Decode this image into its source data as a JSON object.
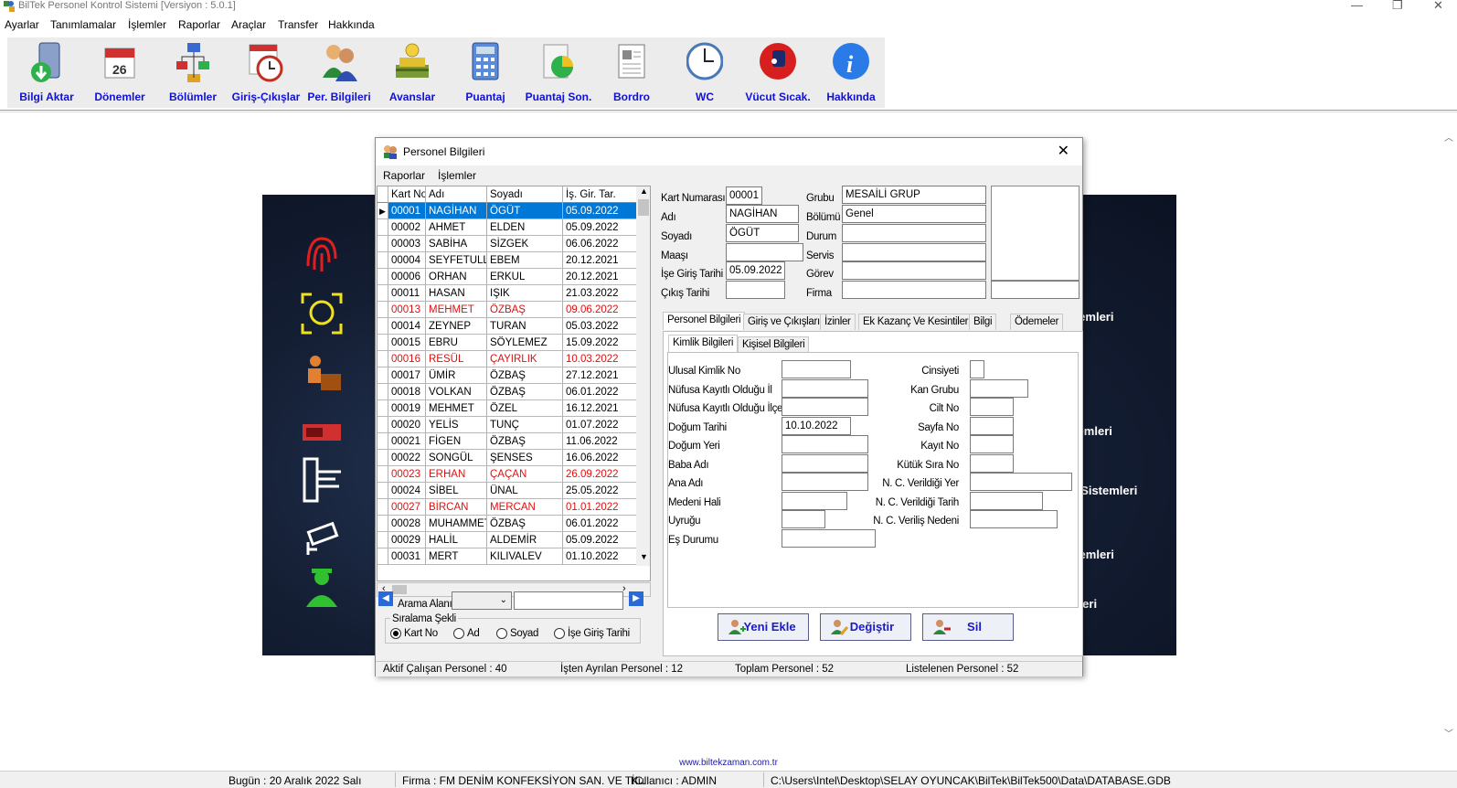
{
  "app": {
    "title": "BilTek Personel Kontrol Sistemi [Versiyon : 5.0.1]"
  },
  "menu": [
    "Ayarlar",
    "Tanımlamalar",
    "İşlemler",
    "Raporlar",
    "Araçlar",
    "Transfer",
    "Hakkında"
  ],
  "toolbar": [
    {
      "label": "Bilgi Aktar",
      "icon": "download-icon"
    },
    {
      "label": "Dönemler",
      "icon": "calendar-icon"
    },
    {
      "label": "Bölümler",
      "icon": "org-chart-icon"
    },
    {
      "label": "Giriş-Çıkışlar",
      "icon": "clock-calendar-icon"
    },
    {
      "label": "Per. Bilgileri",
      "icon": "users-icon"
    },
    {
      "label": "Avanslar",
      "icon": "money-icon"
    },
    {
      "label": "Puantaj",
      "icon": "calculator-icon"
    },
    {
      "label": "Puantaj Son.",
      "icon": "pie-chart-icon"
    },
    {
      "label": "Bordro",
      "icon": "document-icon"
    },
    {
      "label": "WC",
      "icon": "wall-clock-icon"
    },
    {
      "label": "Vücut Sıcak.",
      "icon": "thermometer-icon"
    },
    {
      "label": "Hakkında",
      "icon": "info-icon"
    }
  ],
  "background": {
    "side_texts": [
      "istemleri",
      "stemleri",
      "ol Sistemleri",
      "stemleri",
      "mleri"
    ]
  },
  "dialog": {
    "title": "Personel Bilgileri",
    "menu": [
      "Raporlar",
      "İşlemler"
    ],
    "grid_headers": [
      "Kart No",
      "Adı",
      "Soyadı",
      "İş. Gir. Tar."
    ],
    "rows": [
      {
        "kart": "00001",
        "adi": "NAGİHAN",
        "soyadi": "ÖGÜT",
        "tarih": "05.09.2022",
        "red": false,
        "selected": true
      },
      {
        "kart": "00002",
        "adi": "AHMET",
        "soyadi": "ELDEN",
        "tarih": "05.09.2022",
        "red": false
      },
      {
        "kart": "00003",
        "adi": "SABİHA",
        "soyadi": "SİZGEK",
        "tarih": "06.06.2022",
        "red": false
      },
      {
        "kart": "00004",
        "adi": "SEYFETULLA",
        "soyadi": "EBEM",
        "tarih": "20.12.2021",
        "red": false
      },
      {
        "kart": "00006",
        "adi": "ORHAN",
        "soyadi": "ERKUL",
        "tarih": "20.12.2021",
        "red": false
      },
      {
        "kart": "00011",
        "adi": "HASAN",
        "soyadi": "IŞIK",
        "tarih": "21.03.2022",
        "red": false
      },
      {
        "kart": "00013",
        "adi": "MEHMET",
        "soyadi": "ÖZBAŞ",
        "tarih": "09.06.2022",
        "red": true
      },
      {
        "kart": "00014",
        "adi": "ZEYNEP",
        "soyadi": "TURAN",
        "tarih": "05.03.2022",
        "red": false
      },
      {
        "kart": "00015",
        "adi": "EBRU",
        "soyadi": "SÖYLEMEZ",
        "tarih": "15.09.2022",
        "red": false
      },
      {
        "kart": "00016",
        "adi": "RESÜL",
        "soyadi": "ÇAYIRLIK",
        "tarih": "10.03.2022",
        "red": true
      },
      {
        "kart": "00017",
        "adi": "ÜMİR",
        "soyadi": "ÖZBAŞ",
        "tarih": "27.12.2021",
        "red": false
      },
      {
        "kart": "00018",
        "adi": "VOLKAN",
        "soyadi": "ÖZBAŞ",
        "tarih": "06.01.2022",
        "red": false
      },
      {
        "kart": "00019",
        "adi": "MEHMET",
        "soyadi": "ÖZEL",
        "tarih": "16.12.2021",
        "red": false
      },
      {
        "kart": "00020",
        "adi": "YELİS",
        "soyadi": "TUNÇ",
        "tarih": "01.07.2022",
        "red": false
      },
      {
        "kart": "00021",
        "adi": "FİGEN",
        "soyadi": "ÖZBAŞ",
        "tarih": "11.06.2022",
        "red": false
      },
      {
        "kart": "00022",
        "adi": "SONGÜL",
        "soyadi": "ŞENSES",
        "tarih": "16.06.2022",
        "red": false
      },
      {
        "kart": "00023",
        "adi": "ERHAN",
        "soyadi": "ÇAÇAN",
        "tarih": "26.09.2022",
        "red": true
      },
      {
        "kart": "00024",
        "adi": "SİBEL",
        "soyadi": "ÜNAL",
        "tarih": "25.05.2022",
        "red": false
      },
      {
        "kart": "00027",
        "adi": "BİRCAN",
        "soyadi": "MERCAN",
        "tarih": "01.01.2022",
        "red": true
      },
      {
        "kart": "00028",
        "adi": "MUHAMMET",
        "soyadi": "ÖZBAŞ",
        "tarih": "06.01.2022",
        "red": false
      },
      {
        "kart": "00029",
        "adi": "HALİL",
        "soyadi": "ALDEMİR",
        "tarih": "05.09.2022",
        "red": false
      },
      {
        "kart": "00031",
        "adi": "MERT",
        "soyadi": "KILIVALEV",
        "tarih": "01.10.2022",
        "red": false
      }
    ],
    "search_label": "Arama Alanı",
    "sort_label": "Sıralama Şekli",
    "sort_options": [
      "Kart No",
      "Ad",
      "Soyad",
      "İşe Giriş Tarihi"
    ],
    "fields_left": [
      {
        "label": "Kart Numarası",
        "value": "00001"
      },
      {
        "label": "Adı",
        "value": "NAGİHAN"
      },
      {
        "label": "Soyadı",
        "value": "ÖGÜT"
      },
      {
        "label": "Maaşı",
        "value": ""
      },
      {
        "label": "İşe Giriş Tarihi",
        "value": "05.09.2022"
      },
      {
        "label": "Çıkış Tarihi",
        "value": ""
      }
    ],
    "fields_right": [
      {
        "label": "Grubu",
        "value": "MESAİLİ GRUP"
      },
      {
        "label": "Bölümü",
        "value": "Genel"
      },
      {
        "label": "Durum",
        "value": ""
      },
      {
        "label": "Servis",
        "value": ""
      },
      {
        "label": "Görev",
        "value": ""
      },
      {
        "label": "Firma",
        "value": ""
      }
    ],
    "tabs": [
      "Personel Bilgileri",
      "Giriş ve Çıkışları",
      "İzinler",
      "Ek Kazanç Ve Kesintiler",
      "Bilgi",
      "Ödemeler"
    ],
    "subtabs": [
      "Kimlik Bilgileri",
      "Kişisel Bilgileri"
    ],
    "kimlik_left": [
      {
        "label": "Ulusal Kimlik No",
        "value": ""
      },
      {
        "label": "Nüfusa Kayıtlı Olduğu İl",
        "value": ""
      },
      {
        "label": "Nüfusa Kayıtlı Olduğu İlçe",
        "value": ""
      },
      {
        "label": "Doğum Tarihi",
        "value": "10.10.2022"
      },
      {
        "label": "Doğum Yeri",
        "value": ""
      },
      {
        "label": "Baba Adı",
        "value": ""
      },
      {
        "label": "Ana Adı",
        "value": ""
      },
      {
        "label": "Medeni Hali",
        "value": ""
      },
      {
        "label": "Uyruğu",
        "value": ""
      },
      {
        "label": "Eş Durumu",
        "value": ""
      }
    ],
    "kimlik_right": [
      {
        "label": "Cinsiyeti",
        "value": ""
      },
      {
        "label": "Kan Grubu",
        "value": ""
      },
      {
        "label": "Cilt No",
        "value": ""
      },
      {
        "label": "Sayfa No",
        "value": ""
      },
      {
        "label": "Kayıt No",
        "value": ""
      },
      {
        "label": "Kütük Sıra No",
        "value": ""
      },
      {
        "label": "N. C. Verildiği Yer",
        "value": ""
      },
      {
        "label": "N. C. Verildiği Tarih",
        "value": ""
      },
      {
        "label": "N. C. Veriliş Nedeni",
        "value": ""
      }
    ],
    "buttons": {
      "add": "Yeni Ekle",
      "edit": "Değiştir",
      "delete": "Sil"
    },
    "status": [
      "Aktif Çalışan Personel : 40",
      "İşten Ayrılan Personel : 12",
      "Toplam Personel : 52",
      "Listelenen Personel : 52"
    ]
  },
  "website": "www.biltekzaman.com.tr",
  "statusbar": {
    "date": "Bugün : 20 Aralık 2022 Salı",
    "firm": "Firma : FM DENİM KONFEKSİYON SAN. VE TİC.",
    "user": "Kullanıcı : ADMIN",
    "path": "C:\\Users\\Intel\\Desktop\\SELAY OYUNCAK\\BilTek\\BilTek500\\Data\\DATABASE.GDB"
  }
}
